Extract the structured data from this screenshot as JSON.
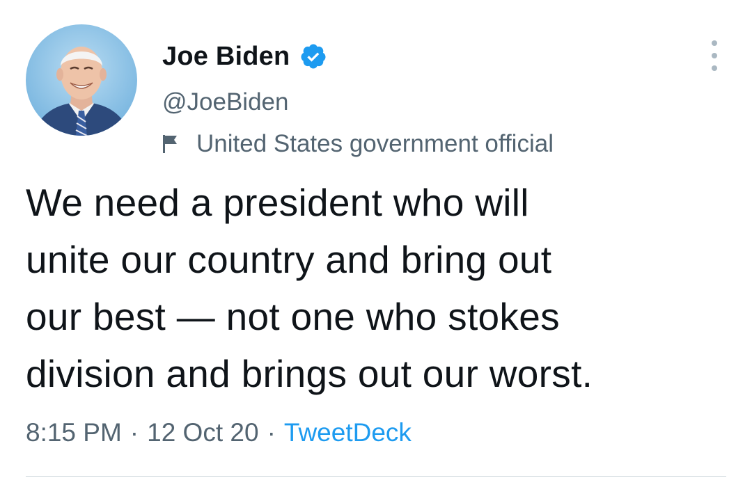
{
  "author": {
    "display_name": "Joe Biden",
    "handle": "@JoeBiden",
    "verified": true,
    "label": "United States government official",
    "avatar_icon": "profile-photo"
  },
  "tweet": {
    "text": "We need a president who will\nunite our country and bring out\nour best — not one who stokes\ndivision and brings out our worst."
  },
  "meta": {
    "time": "8:15 PM",
    "separator": "·",
    "date": "12 Oct 20",
    "source": "TweetDeck"
  },
  "colors": {
    "verified_badge": "#1d9bf0",
    "secondary_text": "#536471",
    "link": "#1d9bf0",
    "avatar_background": "#8ec3e6"
  }
}
